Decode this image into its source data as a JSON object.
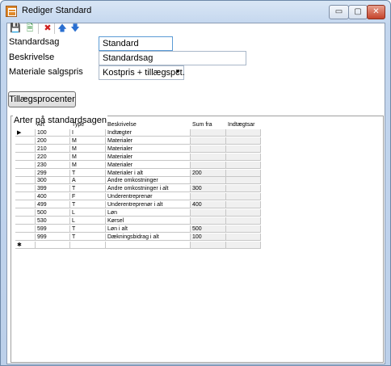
{
  "window": {
    "title": "Rediger Standard",
    "controls": {
      "minimize": "▭",
      "maximize": "▢",
      "close": "✕"
    }
  },
  "toolbar": {
    "icons": [
      "save-icon",
      "new-record-icon",
      "delete-icon",
      "move-up-icon",
      "move-down-icon"
    ]
  },
  "form": {
    "standardsag_label": "Standardsag",
    "standardsag_value": "Standard",
    "beskrivelse_label": "Beskrivelse",
    "beskrivelse_value": "Standardsag",
    "materiale_label": "Materiale salgspris",
    "materiale_value": "Kostpris + tillægspct."
  },
  "buttons": {
    "tillaeg_label": "Tillægsprocenter"
  },
  "group": {
    "title": "Arter på standardsagen"
  },
  "grid": {
    "columns": [
      "Art",
      "Type",
      "Beskrivelse",
      "Sum fra",
      "Indtægtsar"
    ],
    "rows": [
      {
        "art": "100",
        "type": "I",
        "beskrivelse": "Indtægter",
        "sum": "",
        "indt": ""
      },
      {
        "art": "200",
        "type": "M",
        "beskrivelse": "Materialer",
        "sum": "",
        "indt": ""
      },
      {
        "art": "210",
        "type": "M",
        "beskrivelse": "Materialer",
        "sum": "",
        "indt": ""
      },
      {
        "art": "220",
        "type": "M",
        "beskrivelse": "Materialer",
        "sum": "",
        "indt": ""
      },
      {
        "art": "230",
        "type": "M",
        "beskrivelse": "Materialer",
        "sum": "",
        "indt": ""
      },
      {
        "art": "299",
        "type": "T",
        "beskrivelse": "Materialer i alt",
        "sum": "200",
        "indt": ""
      },
      {
        "art": "300",
        "type": "A",
        "beskrivelse": "Andre omkostninger",
        "sum": "",
        "indt": ""
      },
      {
        "art": "399",
        "type": "T",
        "beskrivelse": "Andre omkostninger i alt",
        "sum": "300",
        "indt": ""
      },
      {
        "art": "400",
        "type": "F",
        "beskrivelse": "Underentreprenør",
        "sum": "",
        "indt": ""
      },
      {
        "art": "499",
        "type": "T",
        "beskrivelse": "Underentreprenør i alt",
        "sum": "400",
        "indt": ""
      },
      {
        "art": "500",
        "type": "L",
        "beskrivelse": "Løn",
        "sum": "",
        "indt": ""
      },
      {
        "art": "530",
        "type": "L",
        "beskrivelse": "Kørsel",
        "sum": "",
        "indt": ""
      },
      {
        "art": "599",
        "type": "T",
        "beskrivelse": "Løn i alt",
        "sum": "500",
        "indt": ""
      },
      {
        "art": "999",
        "type": "T",
        "beskrivelse": "Dækningsbidrag i alt",
        "sum": "100",
        "indt": ""
      }
    ],
    "current_row_marker": "▶",
    "new_row_marker": "✱"
  }
}
